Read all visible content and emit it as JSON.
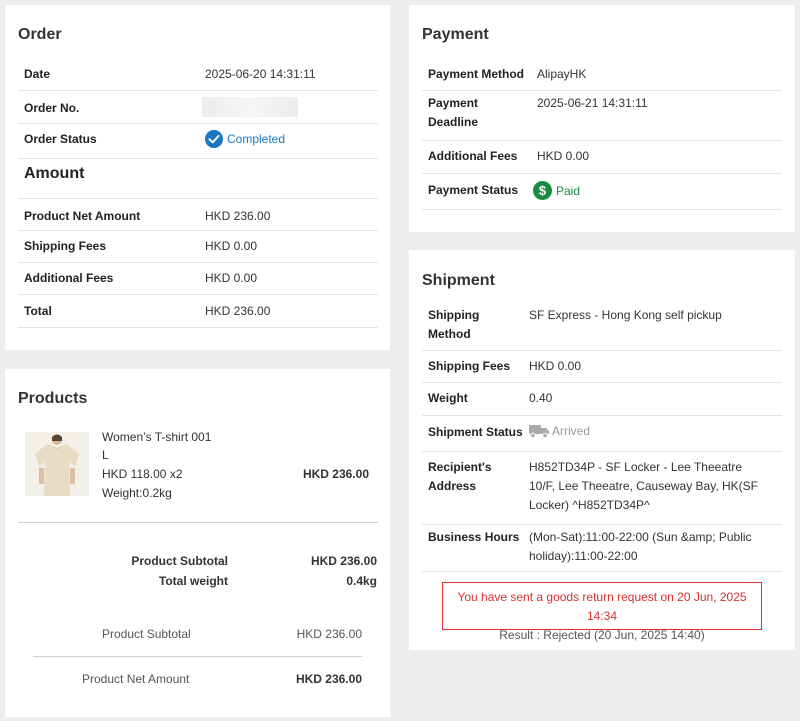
{
  "order": {
    "title": "Order",
    "date_label": "Date",
    "date_value": "2025-06-20 14:31:11",
    "order_no_label": "Order No.",
    "status_label": "Order Status",
    "status_value": "Completed",
    "status_icon": "check-circle-icon"
  },
  "amount": {
    "title": "Amount",
    "net_label": "Product Net Amount",
    "net_value": "HKD 236.00",
    "shipping_label": "Shipping Fees",
    "shipping_value": "HKD 0.00",
    "additional_label": "Additional Fees",
    "additional_value": "HKD 0.00",
    "total_label": "Total",
    "total_value": "HKD 236.00"
  },
  "products": {
    "title": "Products",
    "item": {
      "name": "Women’s T-shirt 001",
      "size": "L",
      "price": "HKD 118.00 x2",
      "weight": "Weight:0.2kg",
      "line_total": "HKD 236.00"
    },
    "subtotal_label": "Product Subtotal",
    "subtotal_value": "HKD 236.00",
    "total_weight_label": "Total weight",
    "total_weight_value": "0.4kg",
    "summary_subtotal_label": "Product Subtotal",
    "summary_subtotal_value": "HKD 236.00",
    "summary_net_label": "Product Net Amount",
    "summary_net_value": "HKD 236.00"
  },
  "payment": {
    "title": "Payment",
    "method_label": "Payment Method",
    "method_value": "AlipayHK",
    "deadline_label_1": "Payment",
    "deadline_label_2": "Deadline",
    "deadline_value": "2025-06-21 14:31:11",
    "additional_label": "Additional Fees",
    "additional_value": "HKD 0.00",
    "status_label": "Payment Status",
    "status_value": "Paid",
    "status_icon": "dollar-circle-icon"
  },
  "shipment": {
    "title": "Shipment",
    "method_label_1": "Shipping",
    "method_label_2": "Method",
    "method_value": "SF Express - Hong Kong self pickup",
    "fees_label": "Shipping Fees",
    "fees_value": "HKD 0.00",
    "weight_label": "Weight",
    "weight_value": "0.40",
    "status_label": "Shipment Status",
    "status_value": "Arrived",
    "status_icon": "truck-icon",
    "address_label_1": "Recipient's",
    "address_label_2": "Address",
    "address_line_1": "H852TD34P - SF Locker - Lee Theeatre",
    "address_line_2": "10/F, Lee Theeatre, Causeway Bay, HK(SF",
    "address_line_3": "Locker) ^H852TD34P^",
    "hours_label": "Business Hours",
    "hours_line_1": "(Mon-Sat):11:00-22:00 (Sun &amp; Public",
    "hours_line_2": "holiday):11:00-22:00"
  },
  "return_request": {
    "line_1": "You have sent a goods return request on 20 Jun, 2025 14:34",
    "line_2": "Result : Rejected (20 Jun, 2025 14:40)"
  },
  "colors": {
    "background": "#eeeeee",
    "paid_green": "#1a8a3e",
    "completed_blue": "#1a78c2",
    "alert_red": "#d63030"
  }
}
